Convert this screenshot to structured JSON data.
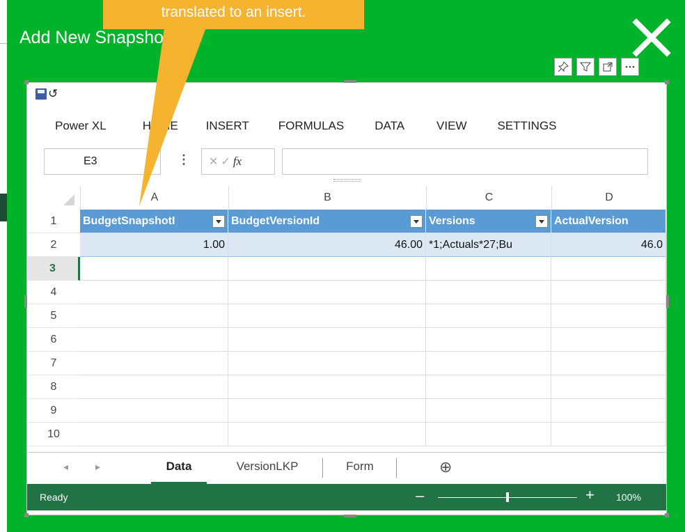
{
  "dialog": {
    "title": "Add New Snapshot"
  },
  "callout": {
    "text": "translated to an insert."
  },
  "visual_toolbar": {
    "icons": [
      "pin-icon",
      "filter-icon",
      "focus-mode-icon",
      "more-options-icon"
    ]
  },
  "workbook": {
    "ribbon_tabs": [
      "Power XL",
      "HOME",
      "INSERT",
      "FORMULAS",
      "DATA",
      "VIEW",
      "SETTINGS"
    ],
    "name_box": "E3",
    "fx_label": "fx",
    "columns": [
      "A",
      "B",
      "C",
      "D"
    ],
    "header_row": [
      "BudgetSnapshotI",
      "BudgetVersionId",
      "Versions",
      "ActualVersion"
    ],
    "data_row": [
      "1.00",
      "46.00",
      "*1;Actuals*27;Bu",
      "46.0"
    ],
    "row_numbers": [
      "1",
      "2",
      "3",
      "4",
      "5",
      "6",
      "7",
      "8",
      "9",
      "10"
    ],
    "sheet_tabs": [
      "Data",
      "VersionLKP",
      "Form"
    ],
    "active_sheet": "Data",
    "status": "Ready",
    "zoom": "100%"
  },
  "colors": {
    "dialog_bg": "#00b32a",
    "callout_bg": "#f6b330",
    "excel_green": "#217346",
    "table_header": "#5b9bd5"
  }
}
